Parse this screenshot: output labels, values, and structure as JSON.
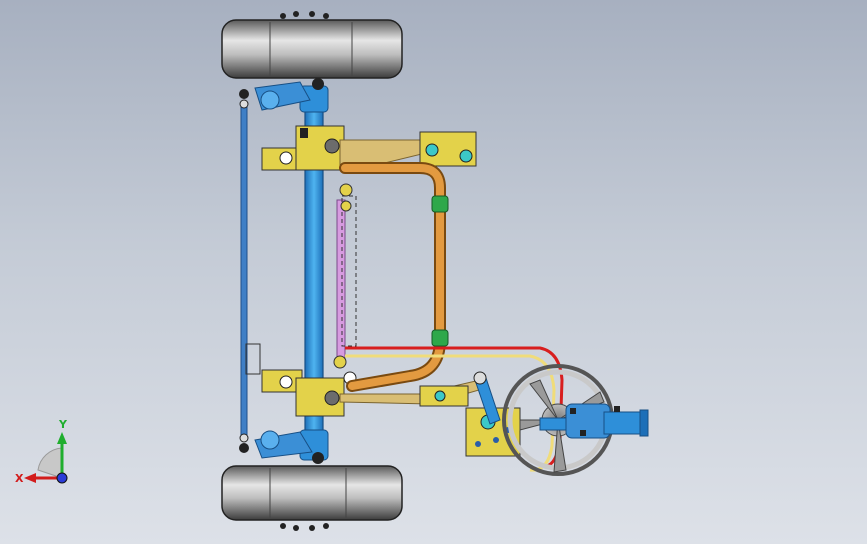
{
  "viewport": {
    "background_top": "#a7b0c0",
    "background_bottom": "#dde1e8"
  },
  "triad": {
    "x_label": "X",
    "y_label": "Y",
    "x_color": "#d21c1c",
    "y_color": "#1fae2e",
    "z_color": "#2a3cd8"
  },
  "part_colors": {
    "tire": "#3a3a3a",
    "axle": "#2e8fd9",
    "knuckle": "#e3d24a",
    "orange_pipe": "#d58a2c",
    "tan_arm": "#d9be74",
    "pink_link": "#d79be0",
    "steel_rod": "#3f7fc6",
    "red_line": "#d81e1e",
    "wheel": "#9a9a9a",
    "bolt": "#111111"
  }
}
